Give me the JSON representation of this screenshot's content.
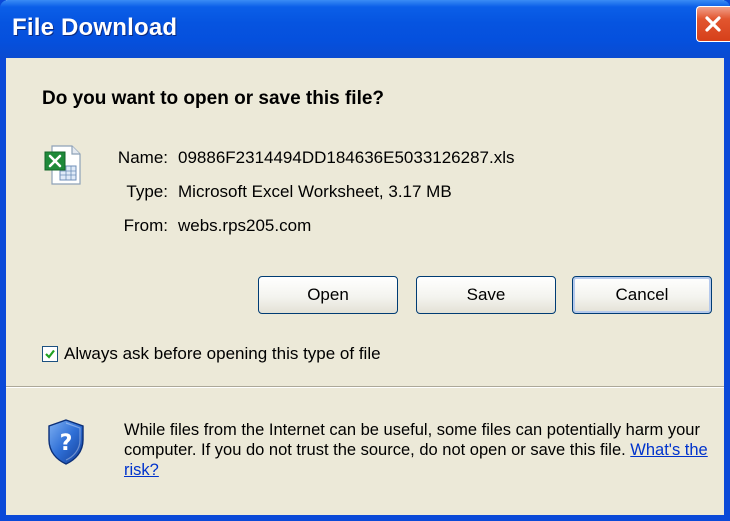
{
  "window": {
    "title": "File Download"
  },
  "dialog": {
    "question": "Do you want to open or save this file?",
    "file": {
      "icon": "excel-file-icon",
      "name_label": "Name:",
      "name_value": "09886F2314494DD184636E5033126287.xls",
      "type_label": "Type:",
      "type_value": "Microsoft Excel Worksheet, 3.17 MB",
      "from_label": "From:",
      "from_value": "webs.rps205.com"
    },
    "buttons": {
      "open": "Open",
      "save": "Save",
      "cancel": "Cancel"
    },
    "always_ask": {
      "checked": true,
      "label": "Always ask before opening this type of file"
    },
    "warning": {
      "icon": "security-shield-icon",
      "text": "While files from the Internet can be useful, some files can potentially harm your computer. If you do not trust the source, do not open or save this file.",
      "link": "What's the risk?"
    }
  },
  "colors": {
    "titlebar": "#0654e0",
    "dialog_bg": "#ece9d8",
    "close_button": "#d6401a",
    "link": "#0033cc"
  }
}
